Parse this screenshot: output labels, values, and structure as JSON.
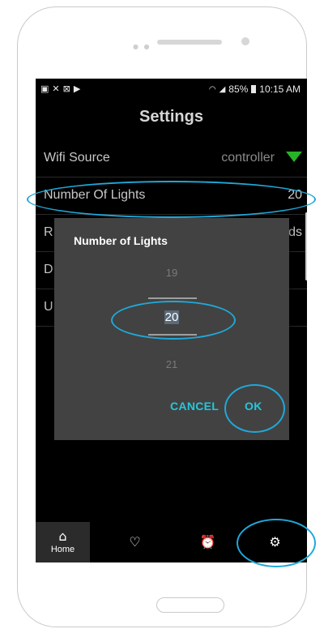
{
  "statusbar": {
    "left_icons": [
      "image-icon",
      "shuffle-icon",
      "notification-icon",
      "play-icon"
    ],
    "battery": "85%",
    "time": "10:15 AM"
  },
  "page": {
    "title": "Settings"
  },
  "settings": [
    {
      "label": "Wifi Source",
      "value": "controller"
    },
    {
      "label": "Number Of Lights",
      "value": "20"
    },
    {
      "label": "R",
      "value": "ds"
    },
    {
      "label": "D",
      "value": ""
    },
    {
      "label": "U",
      "value": ""
    }
  ],
  "dialog": {
    "title": "Number of Lights",
    "prev_value": "19",
    "current_value": "20",
    "next_value": "21",
    "cancel_label": "CANCEL",
    "ok_label": "OK"
  },
  "nav": [
    {
      "label": "Home",
      "icon": "home-icon"
    },
    {
      "label": "",
      "icon": "heart-icon"
    },
    {
      "label": "",
      "icon": "alarm-icon"
    },
    {
      "label": "",
      "icon": "gear-icon"
    }
  ],
  "colors": {
    "accent": "#26c6da",
    "annotation": "#1fa8d9",
    "wifi": "#27b327",
    "dialog": "#424242"
  }
}
